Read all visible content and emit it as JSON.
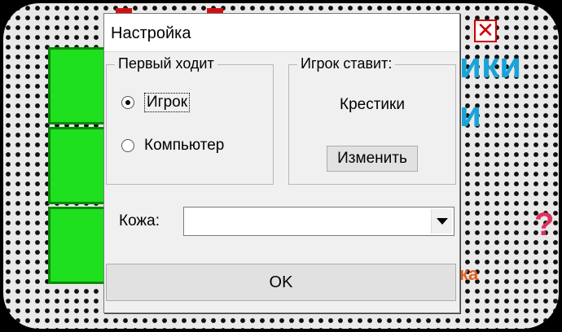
{
  "dialog": {
    "title": "Настройка",
    "first_move": {
      "label": "Первый ходит",
      "options": [
        {
          "label": "Игрок",
          "checked": true
        },
        {
          "label": "Компьютер",
          "checked": false
        }
      ]
    },
    "player_places": {
      "label": "Игрок ставит:",
      "value": "Крестики",
      "change_button": "Изменить"
    },
    "skin": {
      "label": "Кожа:",
      "value": ""
    },
    "ok_button": "OK"
  },
  "background": {
    "close_glyph": "✕",
    "title_fragment_1": "ики",
    "title_fragment_2": "и",
    "help_glyph": "?",
    "bottom_fragment": "ка"
  }
}
